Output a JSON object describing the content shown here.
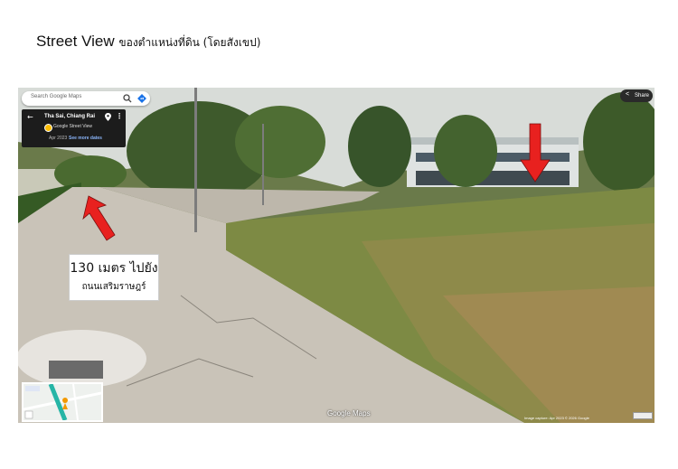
{
  "page": {
    "title_en": "Street View",
    "title_th": "ของตำแหน่งที่ดิน (โดยสังเขป)"
  },
  "street_view": {
    "search": {
      "placeholder": "Search Google Maps"
    },
    "location": {
      "name": "Tha Sai, Chiang Rai",
      "service": "Google Street View",
      "date": "Apr 2023",
      "more_dates_label": "See more dates"
    },
    "share_label": "Share",
    "watermark": "Google Maps",
    "footer": "Image capture: Apr 2023   © 2026 Google",
    "annotation": {
      "line1": "130 เมตร ไปยัง",
      "line2": "ถนนเสริมราษฎร์"
    },
    "arrow_color": "#e8211f",
    "icons": [
      "search-icon",
      "directions-icon",
      "back-arrow-icon",
      "pin-icon",
      "more-options-icon",
      "share-icon"
    ]
  }
}
